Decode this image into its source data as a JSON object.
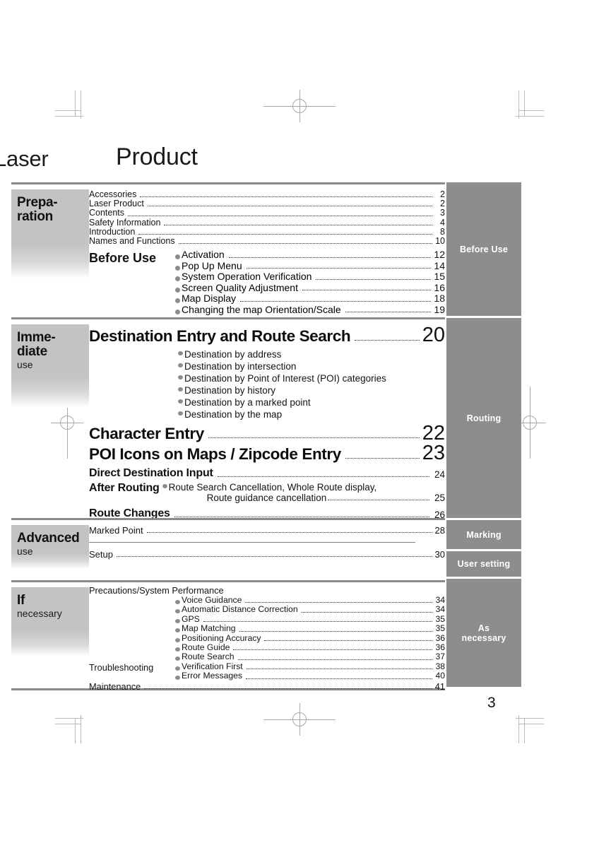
{
  "page": {
    "number": "3",
    "title_left": "Laser",
    "title_right": "Product"
  },
  "right_tabs": [
    {
      "label": "Before Use"
    },
    {
      "label": "Routing"
    },
    {
      "label": "Marking"
    },
    {
      "label": "User setting"
    },
    {
      "label": "As\nnecessary"
    }
  ],
  "sections": [
    {
      "tab_title": "Prepa-\nration",
      "tab_sub": "",
      "plain_entries": [
        {
          "label": "Accessories",
          "page": "2"
        },
        {
          "label": "Laser Product",
          "page": "2"
        },
        {
          "label": "Contents",
          "page": "3"
        },
        {
          "label": "Safety Information",
          "page": "4"
        },
        {
          "label": "Introduction",
          "page": "8"
        },
        {
          "label": "Names and Functions",
          "page": "10"
        }
      ],
      "group": {
        "head": "Before Use",
        "items": [
          {
            "label": "Activation",
            "page": "12"
          },
          {
            "label": "Pop Up Menu",
            "page": "14"
          },
          {
            "label": "System Operation Verification",
            "page": "15"
          },
          {
            "label": "Screen Quality Adjustment",
            "page": "16"
          },
          {
            "label": "Map Display",
            "page": "18"
          },
          {
            "label": "Changing the map Orientation/Scale",
            "page": "19"
          }
        ]
      }
    },
    {
      "tab_title": "Imme-\ndiate",
      "tab_sub": "use",
      "headline": {
        "label": "Destination Entry and Route Search",
        "page": "20"
      },
      "sub_items": [
        "Destination by address",
        "Destination by intersection",
        "Destination by Point of Interest (POI) categories",
        "Destination by history",
        "Destination by a marked point",
        "Destination by the map"
      ],
      "headline2": {
        "label": "Character Entry",
        "page": "22"
      },
      "headline3": {
        "label": "POI Icons on Maps / Zipcode Entry",
        "page": "23"
      },
      "med_entries": [
        {
          "label": "Direct Destination Input",
          "page": "24"
        }
      ],
      "after_routing": {
        "head": "After Routing",
        "line1": "Route Search Cancellation, Whole Route display,",
        "line2": "Route guidance cancellation",
        "page": "25"
      },
      "med_entries2": [
        {
          "label": "Route Changes",
          "page": "26"
        }
      ]
    },
    {
      "tab_title": "Advanced",
      "tab_sub": "use",
      "plain_entries": [
        {
          "label": "Marked Point",
          "page": "28"
        }
      ],
      "plain_entries2": [
        {
          "label": "Setup",
          "page": "30"
        }
      ]
    },
    {
      "tab_title": "If",
      "tab_sub": "necessary",
      "head_note": "Precautions/System Performance",
      "sub_groups": [
        {
          "left": "",
          "rows": [
            {
              "label": "Voice Guidance",
              "page": "34"
            },
            {
              "label": "Automatic Distance Correction",
              "page": "34"
            },
            {
              "label": "GPS",
              "page": "35"
            },
            {
              "label": "Map Matching",
              "page": "35"
            },
            {
              "label": "Positioning Accuracy",
              "page": "36"
            },
            {
              "label": "Route Guide",
              "page": "36"
            },
            {
              "label": "Route Search",
              "page": "37"
            }
          ]
        },
        {
          "left": "Troubleshooting",
          "rows": [
            {
              "label": "Verification First",
              "page": "38"
            },
            {
              "label": "Error Messages",
              "page": "40"
            }
          ]
        }
      ],
      "final_entry": {
        "label": "Maintenance",
        "page": "41"
      }
    }
  ],
  "colors": {
    "tab_grey": "#8d8d8d",
    "left_tab_grey": "#c3c3c3",
    "rule_grey": "#8a8a8a",
    "bullet_grey": "#8c8c8c",
    "text": "#111111"
  }
}
